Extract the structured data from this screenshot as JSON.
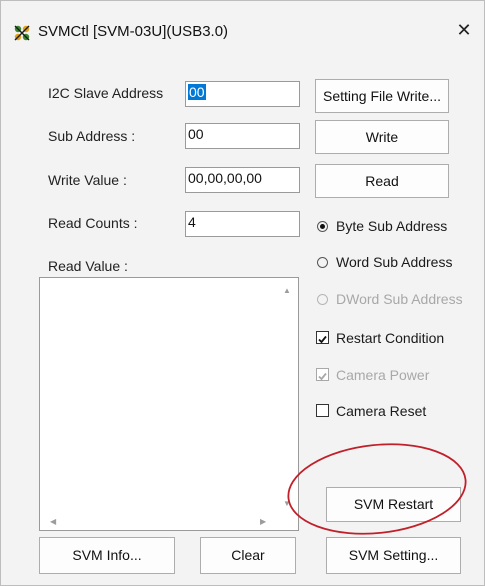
{
  "window": {
    "title": "SVMCtl [SVM-03U](USB3.0)",
    "close_glyph": "✕",
    "app_icon": "svm-app-icon"
  },
  "form": {
    "i2c_label": "I2C Slave Address",
    "i2c_value": "00",
    "sub_label": "Sub Address :",
    "sub_value": "00",
    "write_label": "Write Value :",
    "write_value": "00,00,00,00",
    "count_label": "Read Counts :",
    "count_value": "4",
    "read_value_label": "Read Value :"
  },
  "buttons": {
    "setting_file_write": "Setting File Write...",
    "write": "Write",
    "read": "Read",
    "svm_restart": "SVM Restart",
    "svm_info": "SVM Info...",
    "clear": "Clear",
    "svm_setting": "SVM Setting..."
  },
  "options": {
    "byte_sub": "Byte Sub Address",
    "word_sub": "Word Sub Address",
    "dword_sub": "DWord Sub Address",
    "selected_sub_mode": "byte",
    "restart_condition": "Restart Condition",
    "restart_condition_checked": true,
    "camera_power": "Camera Power",
    "camera_power_checked": true,
    "camera_power_enabled": false,
    "camera_reset": "Camera Reset",
    "camera_reset_checked": false
  },
  "colors": {
    "selection": "#0078d7",
    "annotation": "#c0202a"
  }
}
